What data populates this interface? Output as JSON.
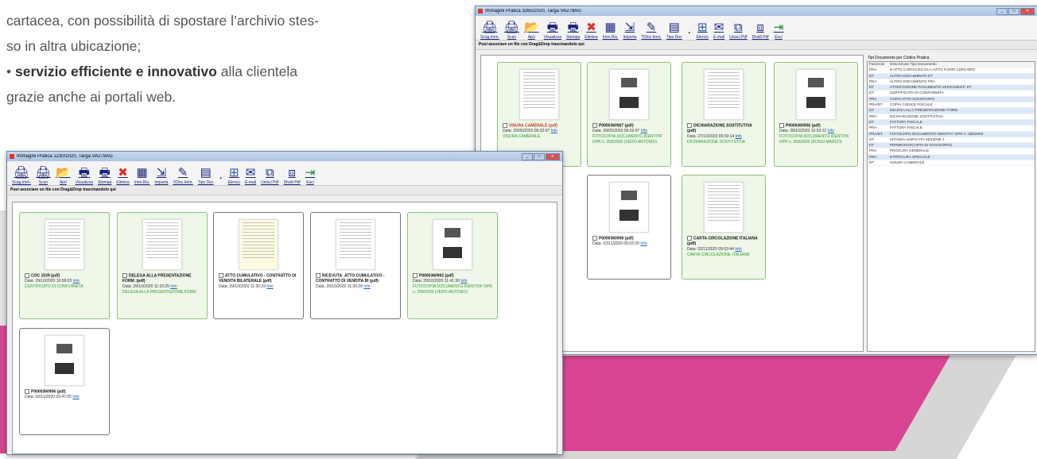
{
  "doc": {
    "line1": "cartacea, con possibilità di spostare l’archivio stes-",
    "line2": "so in altra ubicazione;",
    "bullet": "•",
    "bold": "servizio efficiente e innovativo",
    "rest": " alla clientela",
    "line4": "grazie anche ai portali web."
  },
  "win_right": {
    "title": "Immagini Pratica 3265/2020, Targa VA278AG",
    "drop": "Puoi associare un file con Drag&Drop trascinandolo qui",
    "panel_title": "Tipi Documento per Codice Pratica",
    "col1": "Fascicolo",
    "col2": "Descrizione Tipo Documento",
    "rows": [
      {
        "c": "PRA",
        "d": "● ATTO CARTACEO DU o ATTO FUORI CDPC/DPD"
      },
      {
        "c": "DT",
        "d": "ALTRO DOCUMENTO DT"
      },
      {
        "c": "PRA",
        "d": "ALTRO DOCUMENTO PRA"
      },
      {
        "c": "DT",
        "d": "ATTESTAZIONE PAGAMENTO VERSAMENTI DT"
      },
      {
        "c": "DT",
        "d": "CERTIFICATO DI CONFORMITA"
      },
      {
        "c": "PRA",
        "d": "COPIA ATTO SOCIETARIO"
      },
      {
        "c": "PRA/DT",
        "d": "COPIA CODICE FISCALE"
      },
      {
        "c": "DT",
        "d": "DELEGA ALLA PRESENTAZIONE FORM"
      },
      {
        "c": "PRA",
        "d": "DICHIARAZIONE SOSTITUTIVA"
      },
      {
        "c": "DT",
        "d": "FATTURA FISCALE"
      },
      {
        "c": "PRA",
        "d": "FATTURA FISCALE"
      },
      {
        "c": "PRA/DT",
        "d": "FOTOCOPIA DOCUMENTO IDENTITA' DPR n. 358/2000"
      },
      {
        "c": "DT",
        "d": "ISTANZA UNIFICATA SEZIONE 1"
      },
      {
        "c": "DT",
        "d": "PERMESSO/CARTA DI SOGGIORNO"
      },
      {
        "c": "PRA",
        "d": "PROCURA GENERALE"
      },
      {
        "c": "PRA",
        "d": "● PROCURA SPECIALE"
      },
      {
        "c": "DT",
        "d": "VISURA CAMERALE"
      }
    ],
    "cards": [
      {
        "name": "VISURA CAMERALE (pdf)",
        "date": "Data: 20/05/2020 09:02:07",
        "info": "Info",
        "type": "VISURA CAMERALE",
        "red": true
      },
      {
        "name": "P0000360907 (pdf)",
        "date": "Data: 20/05/2020 09:02:07",
        "info": "Info",
        "type": "FOTOCOPIA DOCUMENTO IDENTITA' DPR n. 358/2000 (VERO ANTONIO)",
        "red": false
      },
      {
        "name": "DICHIARAZIONE SOSTITUTIVA (pdf)",
        "date": "Data: 27/10/2020 09:03:14",
        "info": "Info",
        "type": "DICHIARAZIONE SOSTITUTIVA",
        "red": false
      },
      {
        "name": "P0000360906 (pdf)",
        "date": "Data: 28/10/2020 10:53:12",
        "info": "Info",
        "type": "FOTOCOPIA DOCUMENTO IDENTITA' DPR n. 358/2000 (ROSSI MARCO)",
        "red": false
      },
      {
        "name": "P0000360908 (pdf)",
        "date": "Data: 02/11/2020 09:03:20",
        "info": "Info",
        "type": "",
        "red": false
      },
      {
        "name": "CARTA CIRCOLAZIONE ITALIANA (pdf)",
        "date": "Data: 02/11/2020 09:03:44",
        "info": "Info",
        "type": "CARTA CIRCOLAZIONE ITALIANA",
        "red": false
      }
    ]
  },
  "win_left": {
    "title": "Immagini Pratica 1230/2020, Targa VA278AG",
    "drop": "Puoi associare un file con Drag&Drop trascinandolo qui",
    "cards": [
      {
        "name": "COC 1539 (pdf)",
        "date": "Data: 29/10/2020 10:58:03",
        "info": "Info",
        "type": "CERTIFICATO DI CONFORMITA"
      },
      {
        "name": "DELEGA ALLA PRESENTAZIONE FORM. (pdf)",
        "date": "Data: 29/10/2020 11:16:25",
        "info": "Info",
        "type": "DELEGA ALLA PRESENTAZIONE FORM."
      },
      {
        "name": "ATTO CUMULATIVO - CONTRATTO DI VENDITA BILATERALE (pdf)",
        "date": "Data: 29/10/2020 11:30:29",
        "info": "Info",
        "type": ""
      },
      {
        "name": "RICEVUTA_ATTO CUMULATIVO - CONTRATTO DI VENDITA BI (pdf)",
        "date": "Data: 29/10/2020 11:39:29",
        "info": "Info",
        "type": ""
      },
      {
        "name": "P0000360902 (pdf)",
        "date": "Data: 29/10/2020 11:41:30",
        "info": "Info",
        "type": "FOTOCOPIA DOCUMENTO IDENTITA' DPR n. 358/2000 (VERO ANTONIO)"
      },
      {
        "name": "P0000360906 (pdf)",
        "date": "Data: 02/11/2020 09:47:05",
        "info": "Info",
        "type": ""
      }
    ]
  },
  "toolbar": [
    {
      "icon": "scan-icon",
      "g": "🖨",
      "label": "Scag.Imm."
    },
    {
      "icon": "scanner-icon",
      "g": "🖨",
      "label": "Scan"
    },
    {
      "icon": "folder-icon",
      "g": "📂",
      "label": "Apri"
    },
    {
      "icon": "view-icon",
      "g": "🖶",
      "label": "Visualizza"
    },
    {
      "icon": "print-icon",
      "g": "🖶",
      "label": "Stampa"
    },
    {
      "icon": "delete-icon",
      "g": "✖",
      "label": "Elimina"
    },
    {
      "icon": "image-icon",
      "g": "▦",
      "label": "Imm.Ris."
    },
    {
      "icon": "import-icon",
      "g": "⇲",
      "label": "Importa"
    },
    {
      "icon": "ti-doc-icon",
      "g": "✎",
      "label": "TiDoc.Imm."
    },
    {
      "icon": "doc-type-icon",
      "g": "▤",
      "label": "Tipo Doc"
    },
    {
      "icon": "separator-dot-icon",
      "g": "·",
      "label": ""
    },
    {
      "icon": "grid-icon",
      "g": "⊞",
      "label": "Elenco"
    },
    {
      "icon": "email-icon",
      "g": "✉",
      "label": "E-mail"
    },
    {
      "icon": "merge-pdf-icon",
      "g": "⧉",
      "label": "Unisci Pdf"
    },
    {
      "icon": "split-pdf-icon",
      "g": "⧈",
      "label": "Dividi Pdf"
    },
    {
      "icon": "exit-icon",
      "g": "⇥",
      "label": "Esci"
    }
  ],
  "colors": {
    "accent_pink": "#d94592",
    "card_green": "#eef7e8",
    "red_x": "#d9302c",
    "link_blue": "#1a5fbf"
  }
}
